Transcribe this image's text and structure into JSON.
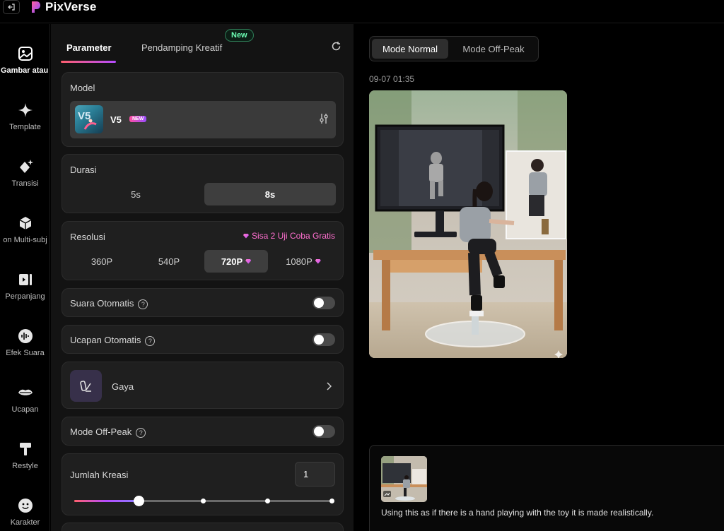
{
  "app": {
    "name": "PixVerse"
  },
  "rail": {
    "items": [
      {
        "label": "Gambar atau",
        "icon": "image-icon"
      },
      {
        "label": "Template",
        "icon": "sparkle-icon"
      },
      {
        "label": "Transisi",
        "icon": "diamond-sparkle-icon"
      },
      {
        "label": "on Multi-subj",
        "icon": "cube-icon"
      },
      {
        "label": "Perpanjang",
        "icon": "extend-video-icon"
      },
      {
        "label": "Efek Suara",
        "icon": "sound-wave-icon"
      },
      {
        "label": "Ucapan",
        "icon": "lips-icon"
      },
      {
        "label": "Restyle",
        "icon": "paint-roller-icon"
      },
      {
        "label": "Karakter",
        "icon": "face-icon"
      }
    ]
  },
  "panel": {
    "tabs": [
      {
        "label": "Parameter"
      },
      {
        "label": "Pendamping Kreatif"
      }
    ],
    "new_badge": "New",
    "model": {
      "label": "Model",
      "name": "V5",
      "badge": "NEW"
    },
    "durasi": {
      "label": "Durasi",
      "options": [
        "5s",
        "8s"
      ],
      "selected": "8s"
    },
    "resolusi": {
      "label": "Resolusi",
      "trial_text": "Sisa 2 Uji Coba Gratis",
      "options": [
        "360P",
        "540P",
        "720P",
        "1080P"
      ],
      "selected": "720P"
    },
    "suara_otomatis": {
      "label": "Suara Otomatis",
      "enabled": false
    },
    "ucapan_otomatis": {
      "label": "Ucapan Otomatis",
      "enabled": false
    },
    "gaya": {
      "label": "Gaya"
    },
    "mode_off_peak": {
      "label": "Mode Off-Peak",
      "enabled": false
    },
    "jumlah_kreasi": {
      "label": "Jumlah Kreasi",
      "value": "1",
      "slider_fraction": 0.25
    }
  },
  "right": {
    "modes": [
      "Mode Normal",
      "Mode Off-Peak"
    ],
    "selected_mode": "Mode Normal",
    "timestamp": "09-07 01:35",
    "prompt": "Using this as if there is a hand playing with the toy it is made realistically."
  },
  "colors": {
    "accent_gradient_start": "#ff5f6d",
    "accent_gradient_end": "#b54cff",
    "new_green": "#6dffb5",
    "trial_pink": "#ff6fcf"
  }
}
